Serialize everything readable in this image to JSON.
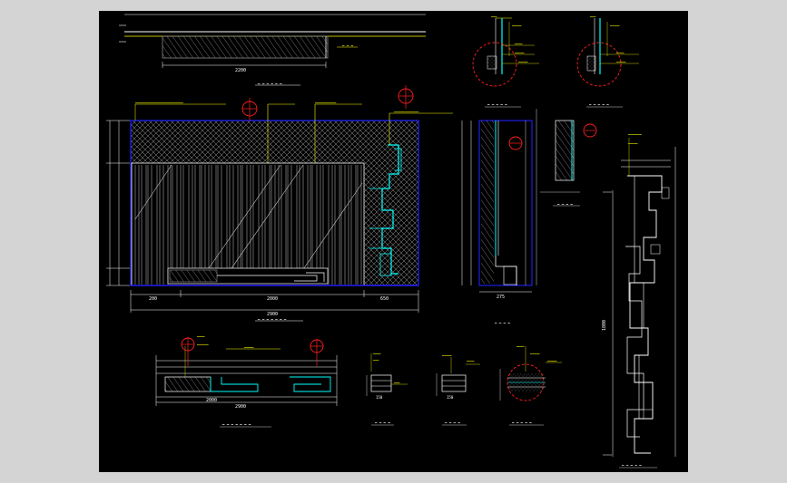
{
  "app": {
    "kind": "CAD drawing viewer",
    "background_color": "#000000",
    "frame_color": "#d4d4d4"
  },
  "palette": {
    "outline": "#1e1ee6",
    "white": "#ffffff",
    "yellow": "#ffff00",
    "cyan": "#00ffff",
    "red": "#ff2020",
    "grey": "#8a8a8a",
    "hatch": "#c8c8c8"
  },
  "notes": {
    "plan_dim": "2200",
    "elev_dim_total": "2900",
    "elev_dim_left": "200",
    "elev_dim_center": "2000",
    "elev_dim_right": "650",
    "section_dim": "275",
    "plan_dim_bottom": "2900",
    "detail_dim": "150",
    "tall_detail_dim": "1800"
  },
  "icons": {
    "callout": "red-circle-callout-icon",
    "section_mark": "red-section-marker-icon"
  }
}
